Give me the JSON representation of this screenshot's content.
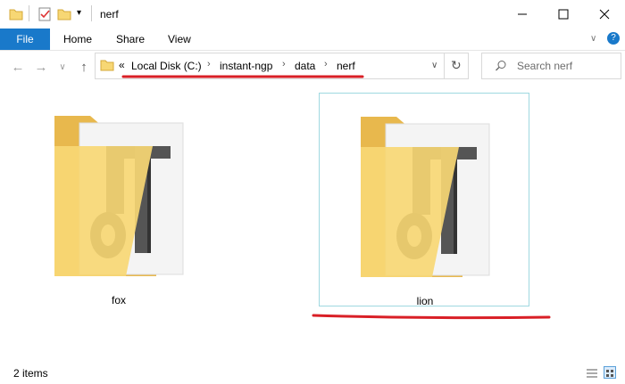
{
  "window": {
    "title": "nerf"
  },
  "ribbon": {
    "file": "File",
    "tabs": [
      "Home",
      "Share",
      "View"
    ]
  },
  "address": {
    "overflow": "«",
    "crumbs": [
      "Local Disk (C:)",
      "instant-ngp",
      "data",
      "nerf"
    ]
  },
  "search": {
    "placeholder": "Search nerf"
  },
  "items": [
    {
      "name": "fox",
      "selected": false
    },
    {
      "name": "lion",
      "selected": true
    }
  ],
  "status": {
    "count": "2 items"
  },
  "colors": {
    "accent": "#1979ca",
    "annotation": "#d91f26",
    "selection_border": "#9fd8e0",
    "folder": "#f7d774"
  }
}
